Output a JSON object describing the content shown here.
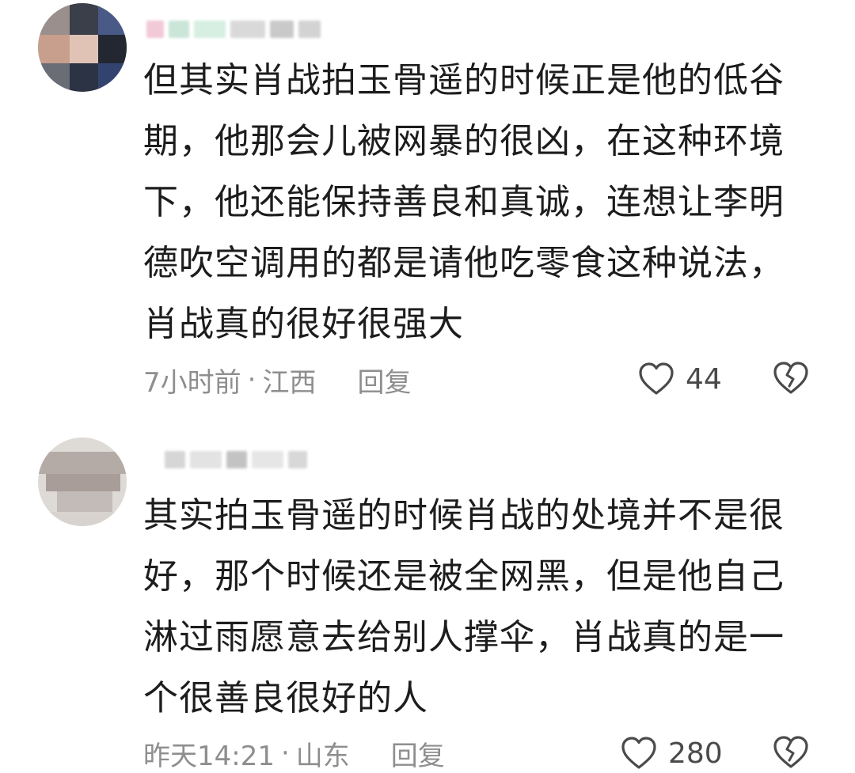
{
  "comments": [
    {
      "text": "但其实肖战拍玉骨遥的时候正是他的低谷\n期，他那会儿被网暴的很凶，在这种环境\n下，他还能保持善良和真诚，连想让李明\n德吹空调用的都是请他吃零食这种说法，\n肖战真的很好很强大",
      "time": "7小时前",
      "separator": "·",
      "location": "江西",
      "reply_label": "回复",
      "like_count": "44"
    },
    {
      "text": "其实拍玉骨遥的时候肖战的处境并不是很\n好，那个时候还是被全网黑，但是他自己\n淋过雨愿意去给别人撑伞，肖战真的是一\n个很善良很好的人",
      "time": "昨天14:21",
      "separator": "·",
      "location": "山东",
      "reply_label": "回复",
      "like_count": "280"
    }
  ],
  "colors": {
    "text": "#1d1d1d",
    "meta": "#8e8e8e",
    "icon": "#4a4a4a"
  },
  "icons": {
    "like": "heart-outline-icon",
    "dislike": "broken-heart-icon"
  }
}
